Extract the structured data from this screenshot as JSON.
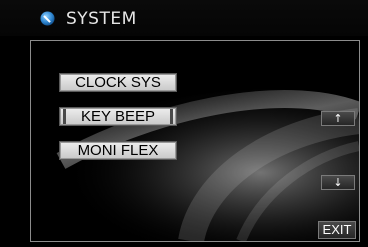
{
  "header": {
    "title": "SYSTEM",
    "icon": "circle-logo-icon"
  },
  "menu": {
    "items": [
      {
        "label": "CLOCK SYS"
      },
      {
        "label": "KEY BEEP"
      },
      {
        "label": "MONI FLEX"
      }
    ]
  },
  "controls": {
    "up_label": "↑",
    "down_label": "↓",
    "exit_label": "EXIT"
  },
  "colors": {
    "accent": "#3a8fd6",
    "background": "#000000",
    "button_face": "#dddddd"
  }
}
